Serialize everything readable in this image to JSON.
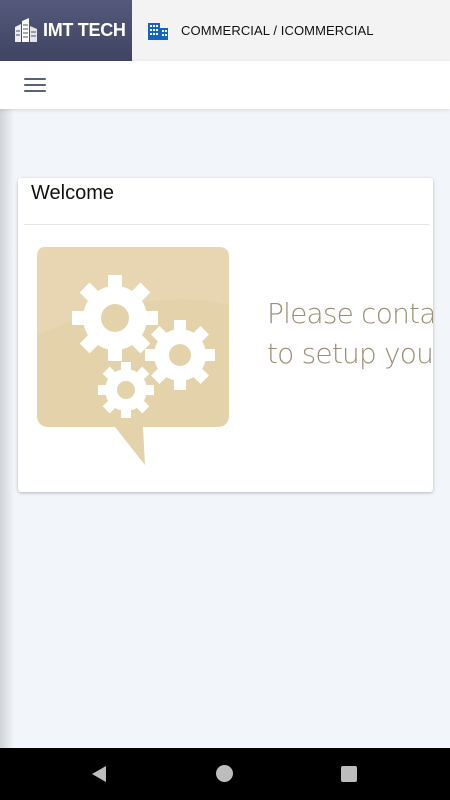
{
  "header": {
    "brand": "IMT TECH",
    "org_path": "COMMERCIAL / ICOMMERCIAL"
  },
  "icons": {
    "logo": "building-logo-icon",
    "org": "building-icon",
    "menu": "hamburger-menu-icon",
    "illustration": "gears-speech-bubble-icon"
  },
  "card": {
    "title": "Welcome",
    "notice_line1": "Please contact",
    "notice_line2": "to setup your r"
  },
  "nav": {
    "back": "back-icon",
    "home": "home-icon",
    "recent": "recent-apps-icon"
  },
  "colors": {
    "brand_bg": "#4b5070",
    "notice_text": "#9a8e74",
    "bubble": "#e3d2aa",
    "org_icon": "#1565c0"
  }
}
